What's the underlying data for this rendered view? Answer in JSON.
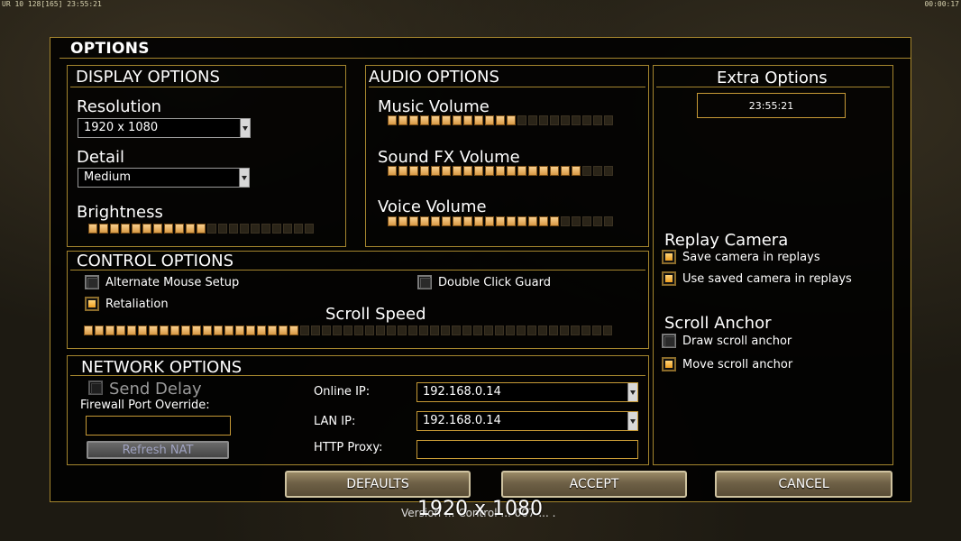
{
  "hud": {
    "left": "UR 10 128[165] 23:55:21",
    "right": "00:00:17"
  },
  "title": "OPTIONS",
  "display": {
    "header": "DISPLAY OPTIONS",
    "resolution_label": "Resolution",
    "resolution_value": "1920 x 1080",
    "detail_label": "Detail",
    "detail_value": "Medium",
    "brightness_label": "Brightness",
    "brightness_level": 0.52
  },
  "audio": {
    "header": "AUDIO OPTIONS",
    "music_label": "Music Volume",
    "music_level": 0.57,
    "sfx_label": "Sound FX Volume",
    "sfx_level": 0.88,
    "voice_label": "Voice Volume",
    "voice_level": 0.75
  },
  "extra": {
    "header": "Extra Options",
    "clock": "23:55:21"
  },
  "control": {
    "header": "CONTROL OPTIONS",
    "alt_mouse": "Alternate Mouse Setup",
    "double_click": "Double Click Guard",
    "retaliation": "Retaliation",
    "scroll_speed_label": "Scroll Speed",
    "scroll_speed_level": 0.41
  },
  "replay": {
    "header": "Replay Camera",
    "save_camera": "Save camera in replays",
    "use_saved": "Use saved camera in replays"
  },
  "scroll_anchor": {
    "header": "Scroll Anchor",
    "draw": "Draw scroll anchor",
    "move": "Move scroll anchor"
  },
  "network": {
    "header": "NETWORK OPTIONS",
    "send_delay": "Send Delay",
    "firewall_label": "Firewall Port Override:",
    "firewall_value": "",
    "refresh_nat": "Refresh NAT",
    "online_ip_label": "Online IP:",
    "online_ip_value": "192.168.0.14",
    "lan_ip_label": "LAN IP:",
    "lan_ip_value": "192.168.0.14",
    "http_proxy_label": "HTTP Proxy:",
    "http_proxy_value": ""
  },
  "buttons": {
    "defaults": "DEFAULTS",
    "accept": "ACCEPT",
    "cancel": "CANCEL"
  },
  "overlay": {
    "resolution": "1920 x 1080",
    "version": "Version ... Control ... 007 ... ."
  },
  "colors": {
    "accent": "#a5862e",
    "slider_on": "#f0b868",
    "checkbox_on": "#f0a020"
  }
}
